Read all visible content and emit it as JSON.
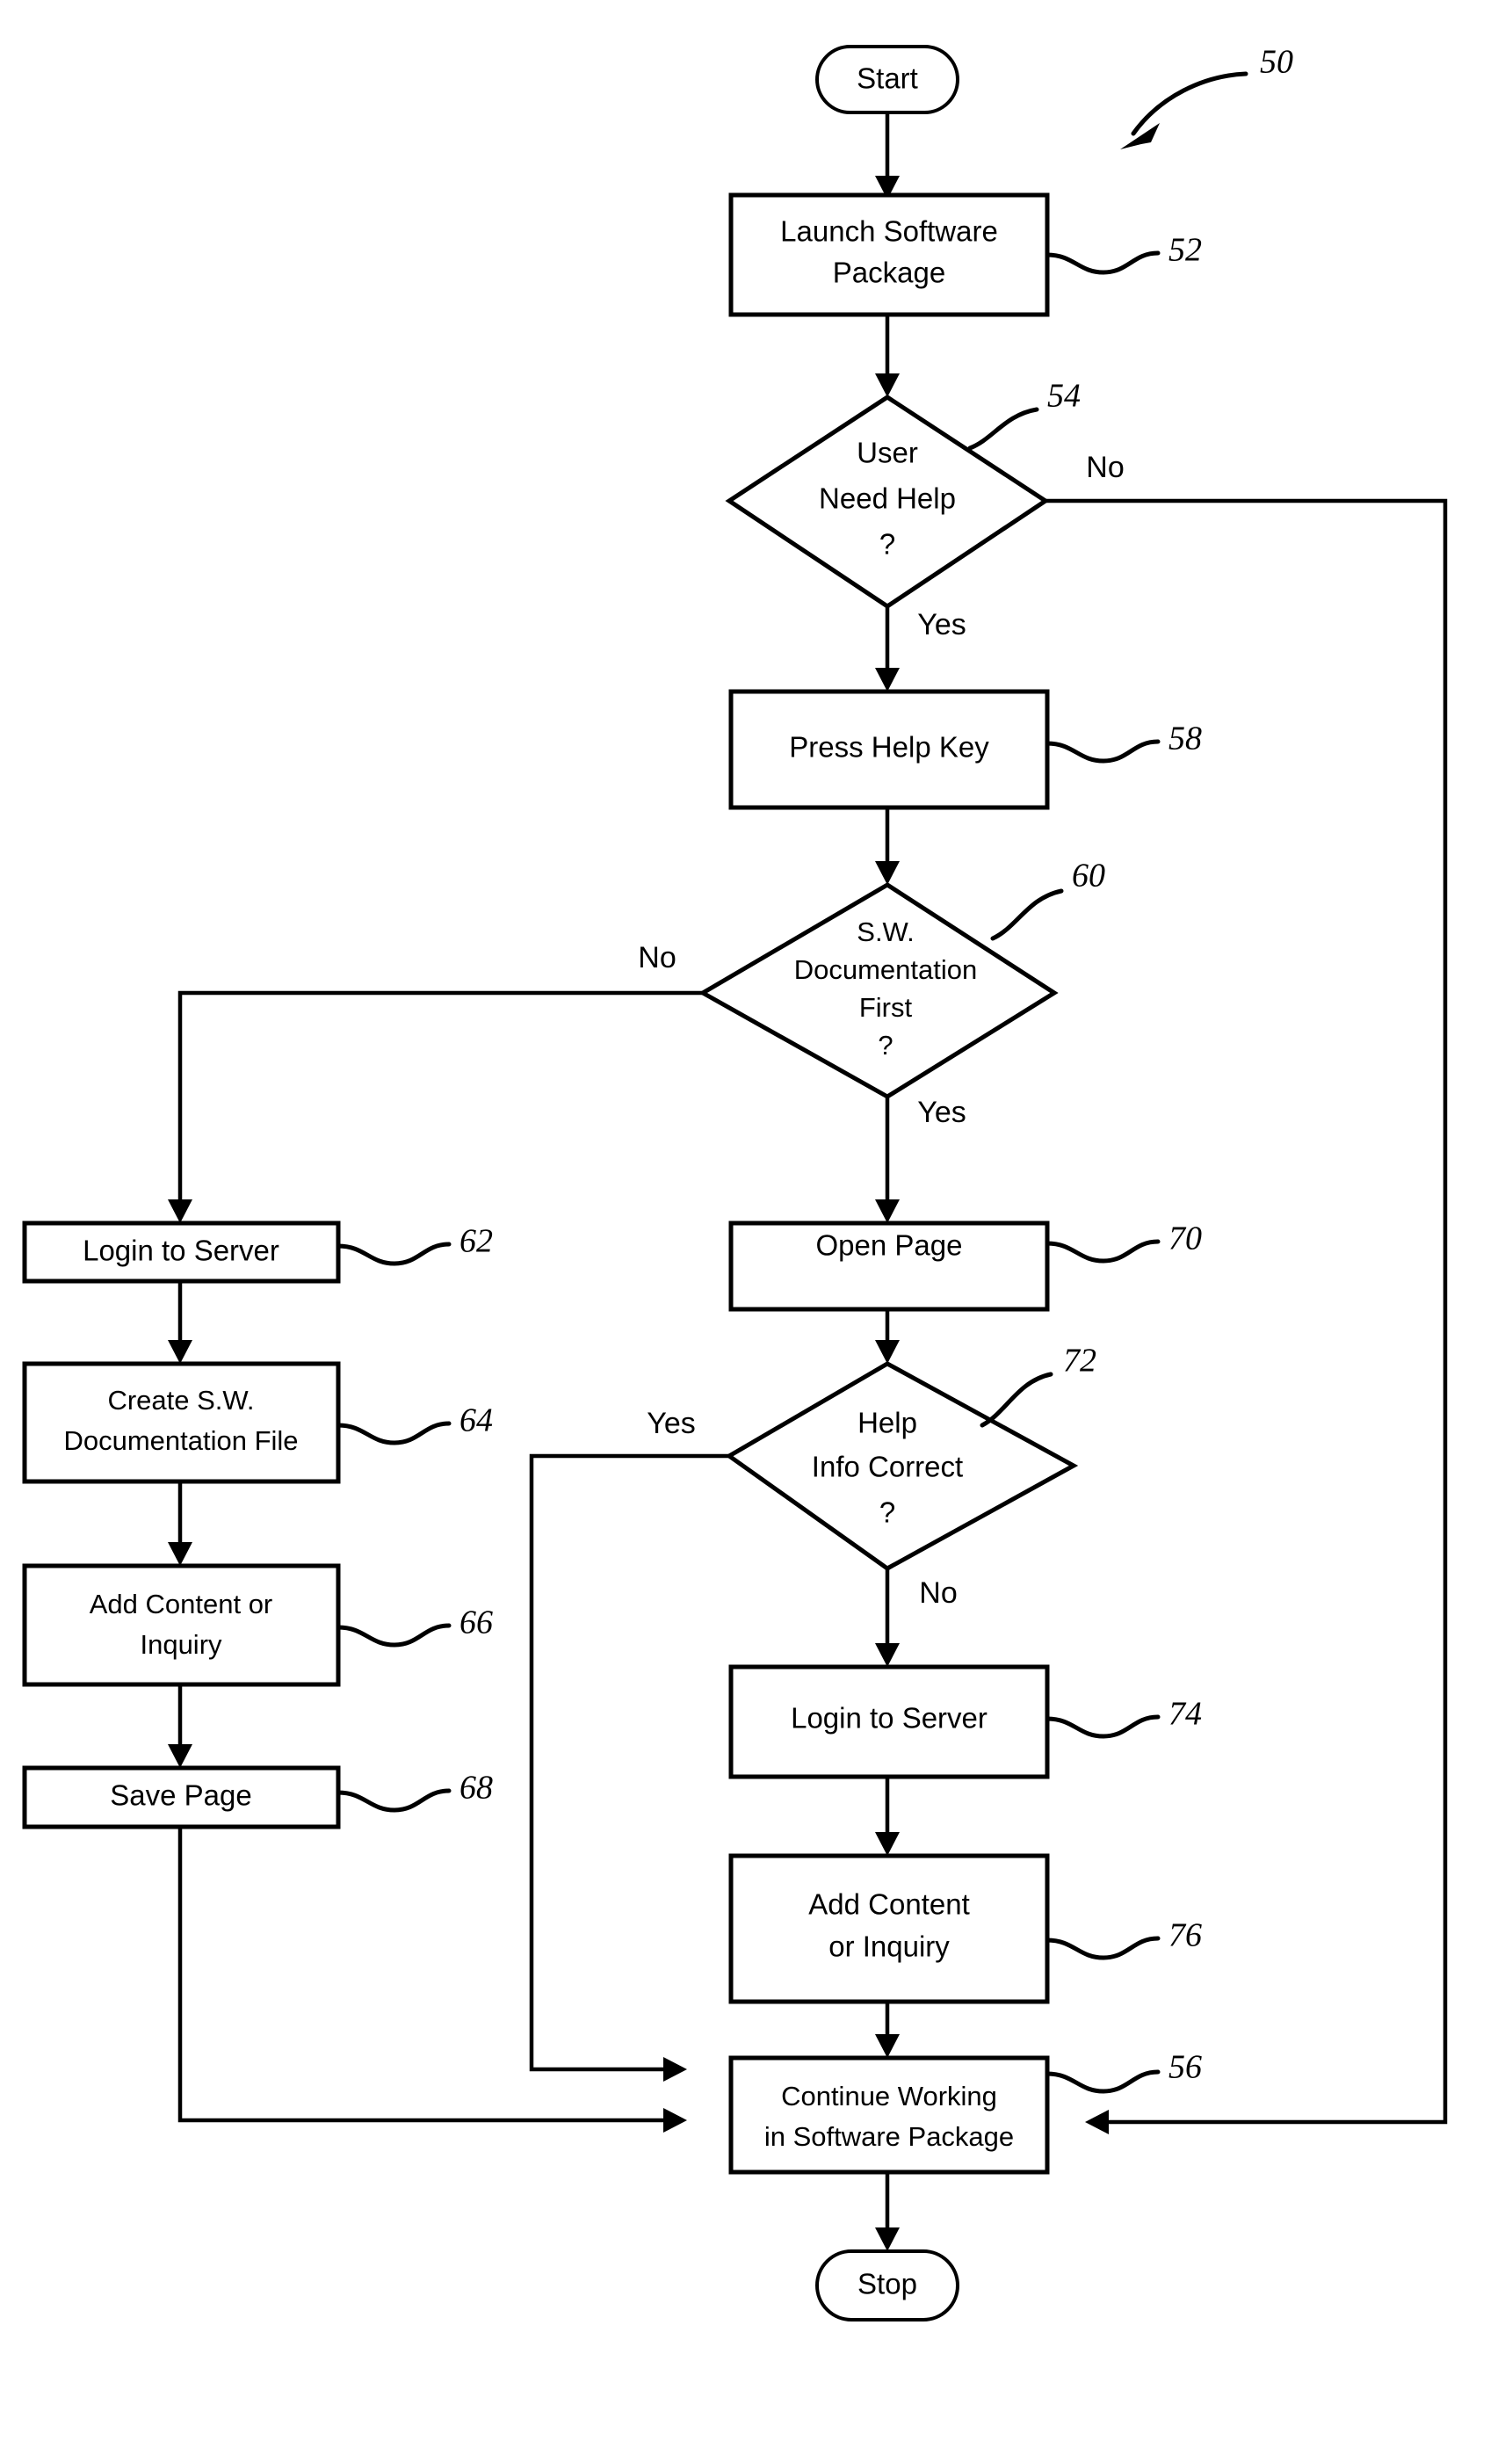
{
  "figure": {
    "ref_number": "50",
    "type": "flowchart"
  },
  "terminators": {
    "start": "Start",
    "stop": "Stop"
  },
  "nodes": {
    "launch_software": {
      "line1": "Launch Software",
      "line2": "Package",
      "ref": "52"
    },
    "user_need_help": {
      "line1": "User",
      "line2": "Need Help",
      "line3": "?",
      "ref": "54"
    },
    "press_help_key": {
      "line1": "Press Help Key",
      "ref": "58"
    },
    "sw_doc_first": {
      "line1": "S.W.",
      "line2": "Documentation",
      "line3": "First",
      "line4": "?",
      "ref": "60"
    },
    "login_to_server_left": {
      "line1": "Login to Server",
      "ref": "62"
    },
    "create_sw_doc_file": {
      "line1": "Create S.W.",
      "line2": "Documentation File",
      "ref": "64"
    },
    "add_content_or_inquiry_left": {
      "line1": "Add Content or",
      "line2": "Inquiry",
      "ref": "66"
    },
    "save_page": {
      "line1": "Save Page",
      "ref": "68"
    },
    "open_page": {
      "line1": "Open Page",
      "ref": "70"
    },
    "help_info_correct": {
      "line1": "Help",
      "line2": "Info Correct",
      "line3": "?",
      "ref": "72"
    },
    "login_to_server_right": {
      "line1": "Login to Server",
      "ref": "74"
    },
    "add_content_or_inquiry_right": {
      "line1": "Add Content",
      "line2": "or Inquiry",
      "ref": "76"
    },
    "continue_working": {
      "line1": "Continue Working",
      "line2": "in Software Package",
      "ref": "56"
    }
  },
  "branch_labels": {
    "user_need_help_no": "No",
    "user_need_help_yes": "Yes",
    "sw_doc_first_no": "No",
    "sw_doc_first_yes": "Yes",
    "help_info_correct_yes": "Yes",
    "help_info_correct_no": "No"
  },
  "colors": {
    "stroke": "#000000",
    "fill": "#ffffff",
    "background": "#ffffff"
  }
}
